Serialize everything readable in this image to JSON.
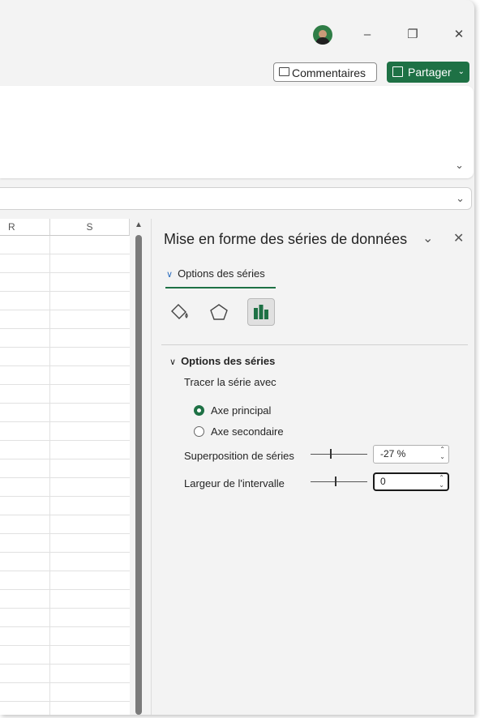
{
  "window": {
    "avatar_name": "user-avatar",
    "minimize_glyph": "–",
    "restore_glyph": "❐",
    "close_glyph": "✕"
  },
  "header": {
    "comments_label": "Commentaires",
    "share_label": "Partager",
    "accent_color": "#1e7145"
  },
  "grid": {
    "columns": [
      "R",
      "S"
    ]
  },
  "pane": {
    "title": "Mise en forme des séries de données",
    "tab_label": "Options des séries",
    "icons": [
      "fill-line-icon",
      "effects-pentagon-icon",
      "series-options-icon"
    ],
    "group": {
      "title": "Options des séries",
      "plot_on_label": "Tracer la série avec",
      "primary_axis_label": "Axe principal",
      "secondary_axis_label": "Axe secondaire",
      "primary_selected": true,
      "overlap": {
        "label": "Superposition de séries",
        "value": "-27 %"
      },
      "gap_width": {
        "label": "Largeur de l'intervalle",
        "value": "0"
      }
    }
  }
}
